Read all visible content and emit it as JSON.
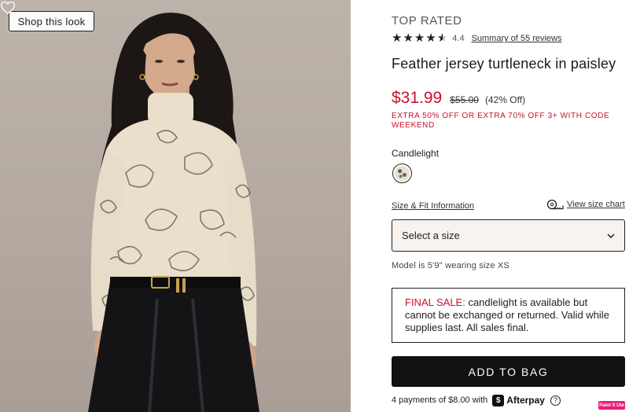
{
  "photo": {
    "shop_look_label": "Shop this look",
    "wishlist_icon": "heart-outline-icon"
  },
  "product": {
    "badge": "TOP RATED",
    "rating": "4.4",
    "rating_stars": 4.4,
    "reviews_link": "Summary of 55 reviews",
    "title": "Feather jersey turtleneck in paisley",
    "price_sale": "$31.99",
    "price_original": "$55.00",
    "price_discount": "(42% Off)",
    "promo": "EXTRA 50% OFF OR EXTRA 70% OFF 3+ WITH CODE WEEKEND",
    "color_name": "Candlelight",
    "size_fit_link": "Size & Fit Information",
    "size_chart_link": "View size chart",
    "size_select_value": "Select a size",
    "model_note": "Model is 5'9\" wearing size XS",
    "final_sale_label": "FINAL SALE:",
    "final_sale_text": " candlelight is available but cannot be exchanged or returned. Valid while supplies last. All sales final.",
    "add_to_bag": "ADD TO BAG",
    "afterpay_text": "4 payments of $8.00 with",
    "afterpay_name": "Afterpay",
    "afterpay_help": "?"
  },
  "extension_badge": "Paint X Ute",
  "colors": {
    "sale_red": "#c8102e",
    "button_black": "#111111",
    "select_bg": "#f8f3ee"
  }
}
